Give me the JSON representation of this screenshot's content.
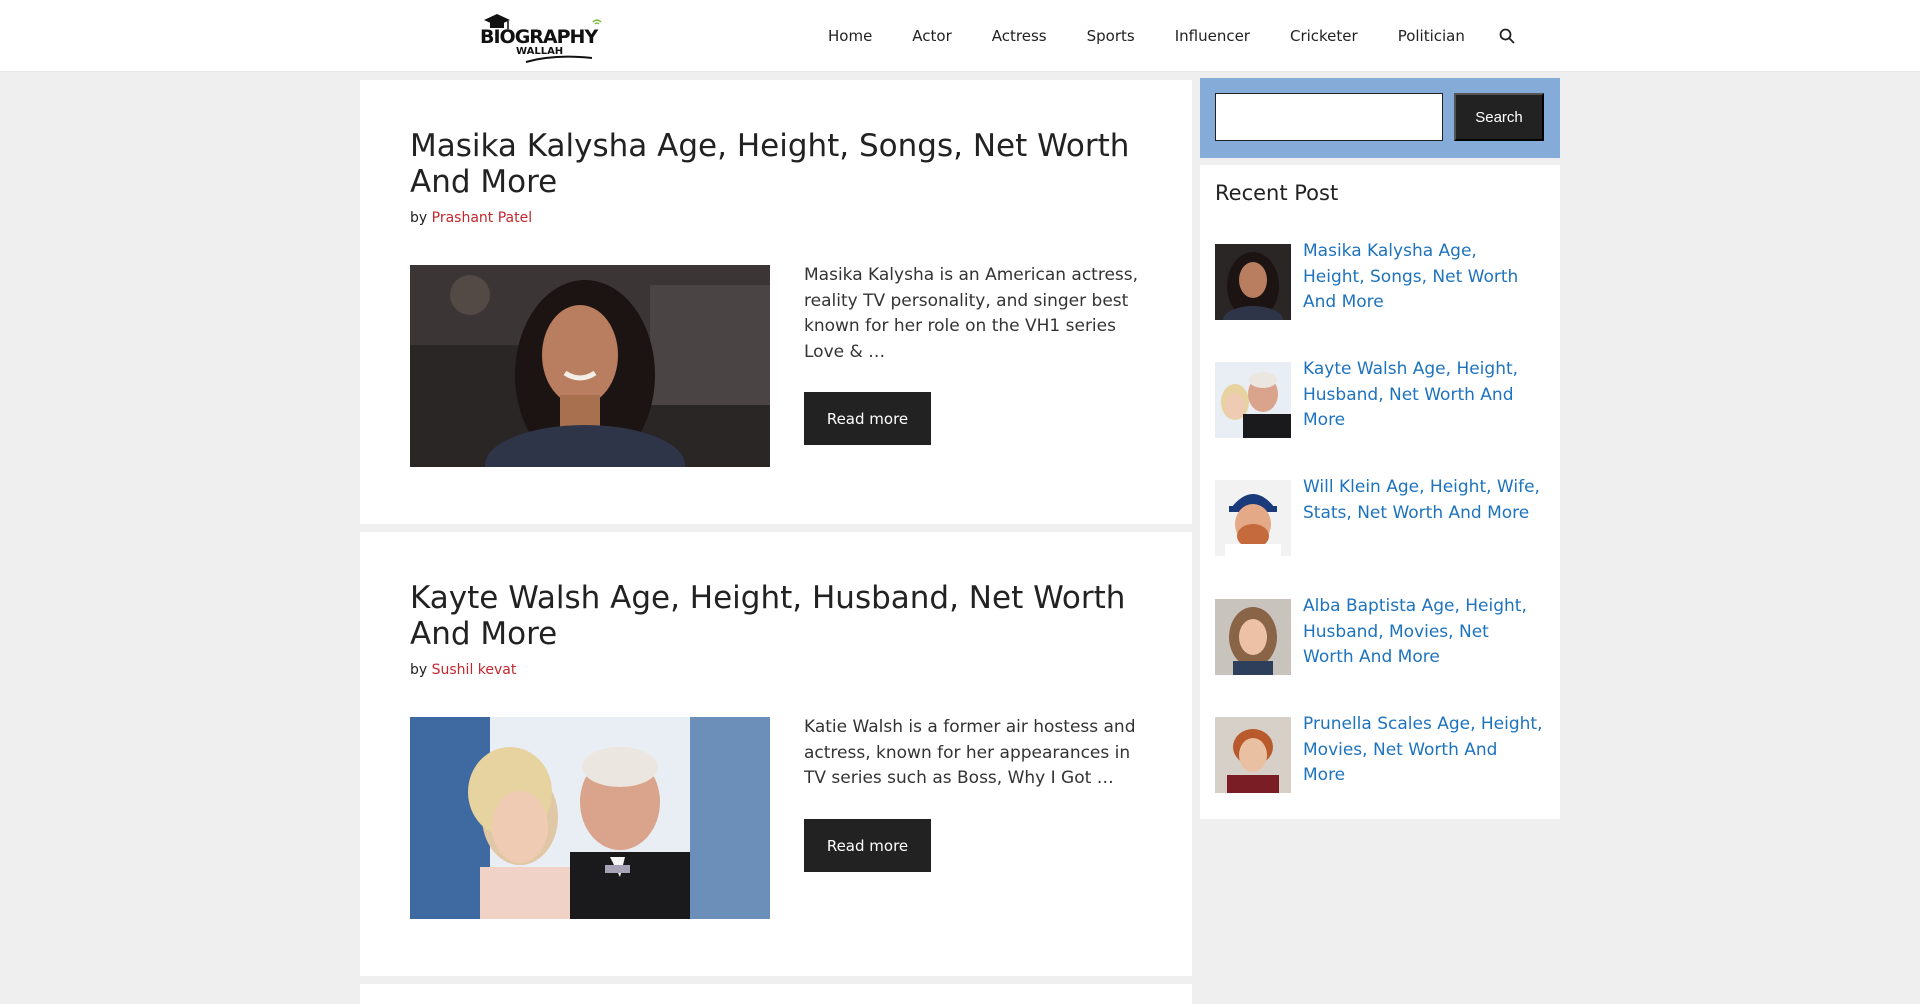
{
  "header": {
    "logo_text": "BIOGRAPHY",
    "logo_sub": "WALLAH",
    "nav": [
      "Home",
      "Actor",
      "Actress",
      "Sports",
      "Influencer",
      "Cricketer",
      "Politician"
    ],
    "search_icon": "search-icon"
  },
  "articles": [
    {
      "title": "Masika Kalysha Age, Height, Songs, Net Worth And More",
      "by": "by",
      "author": "Prashant Patel",
      "excerpt": "Masika Kalysha is an American actress, reality TV personality, and singer best known for her role on the VH1 series Love & …",
      "read_more": "Read more"
    },
    {
      "title": "Kayte Walsh Age, Height, Husband, Net Worth And More",
      "by": "by",
      "author": "Sushil kevat",
      "excerpt": "Katie Walsh is a former air hostess and actress, known for her appearances in TV series such as Boss, Why I Got …",
      "read_more": "Read more"
    }
  ],
  "sidebar": {
    "search_button": "Search",
    "search_placeholder": "",
    "recent_title": "Recent Post",
    "recent": [
      "Masika Kalysha Age, Height, Songs, Net Worth And More",
      "Kayte Walsh Age, Height, Husband, Net Worth And More",
      "Will Klein Age, Height, Wife, Stats, Net Worth And More",
      "Alba Baptista Age, Height, Husband, Movies, Net Worth And More",
      "Prunella Scales Age, Height, Movies, Net Worth And More"
    ]
  },
  "colors": {
    "accent_link": "#1e73be",
    "author_link": "#c1272d",
    "search_widget_bg": "#85acd8",
    "button_bg": "#222222"
  }
}
